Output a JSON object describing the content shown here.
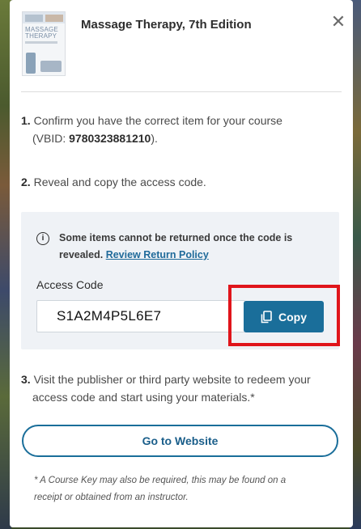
{
  "modal": {
    "book_title": "Massage Therapy, 7th Edition",
    "cover": {
      "title_line1": "MASSAGE",
      "title_line2": "THERAPY"
    },
    "close_glyph": "✕"
  },
  "steps": {
    "step1_number": "1.",
    "step1_text": "Confirm you have the correct item for your course",
    "step1_vbid_prefix": "(VBID: ",
    "step1_vbid": "9780323881210",
    "step1_vbid_suffix": ").",
    "step2_number": "2.",
    "step2_text": "Reveal and copy the access code.",
    "step3_number": "3.",
    "step3_line1": "Visit the publisher or third party website to redeem your",
    "step3_line2": "access code and start using your materials.*"
  },
  "panel": {
    "info_glyph": "i",
    "warning_line1": "Some items cannot be returned once the code is",
    "warning_line2_prefix": "revealed. ",
    "policy_link": "Review Return Policy",
    "access_label": "Access Code",
    "access_code": "S1A2M4P5L6E7",
    "copy_label": "Copy"
  },
  "actions": {
    "website_button": "Go to Website"
  },
  "footnote": {
    "line1": "* A Course Key may also be required, this may be found on a",
    "line2": "receipt or obtained from an instructor."
  },
  "icons": {
    "close": "close-icon",
    "info": "info-icon",
    "copy": "copy-icon"
  },
  "colors": {
    "accent": "#1a6e9a",
    "highlight": "#e0151b",
    "panel_bg": "#eff2f6"
  }
}
